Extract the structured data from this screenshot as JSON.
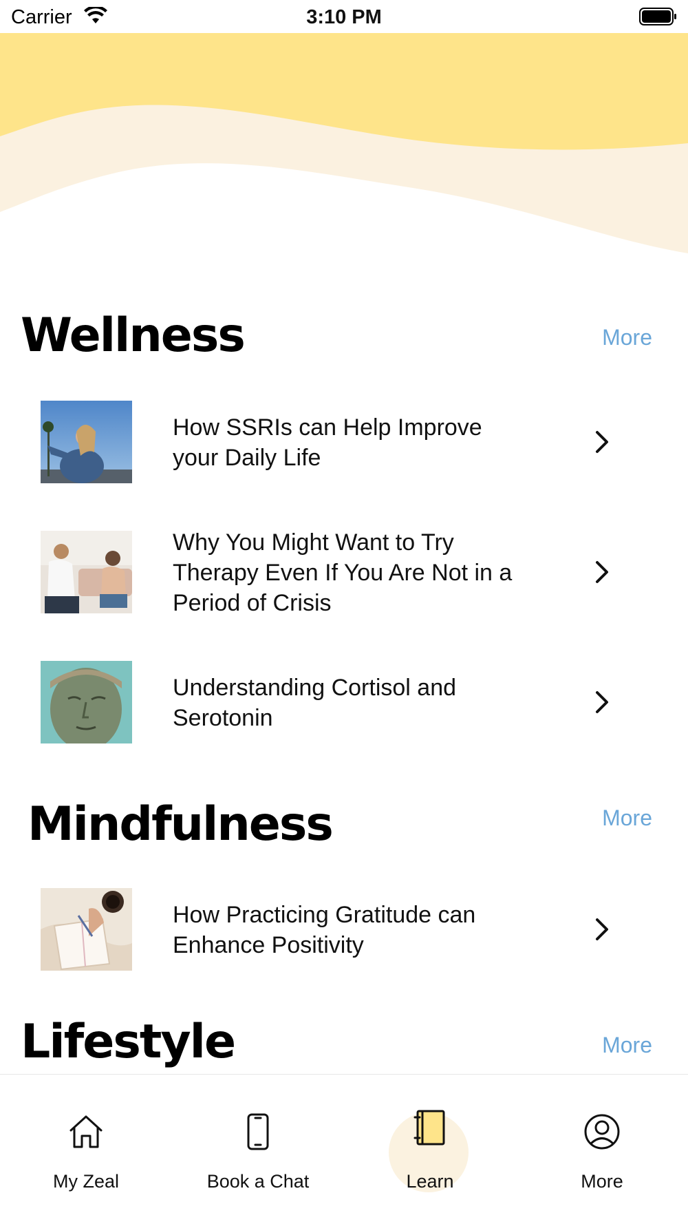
{
  "status": {
    "carrier": "Carrier",
    "time": "3:10 PM"
  },
  "colors": {
    "hero_yellow": "#fee48a",
    "hero_cream": "#fbf1e0",
    "link": "#6aa6d8",
    "tab_active_bg": "#fbf2e0"
  },
  "sections": [
    {
      "title": "Wellness",
      "more": "More",
      "articles": [
        {
          "title": "How SSRIs can Help Improve your Daily Life",
          "thumb": "woman-sky-photo"
        },
        {
          "title": "Why You Might Want to Try Therapy Even If You Are Not in a Period of Crisis",
          "thumb": "therapy-session-photo"
        },
        {
          "title": "Understanding Cortisol and Serotonin",
          "thumb": "statue-head-photo"
        }
      ]
    },
    {
      "title": "Mindfulness",
      "more": "More",
      "articles": [
        {
          "title": "How Practicing Gratitude can Enhance Positivity",
          "thumb": "journal-coffee-photo"
        }
      ]
    },
    {
      "title": "Lifestyle",
      "more": "More",
      "articles": []
    }
  ],
  "tabs": [
    {
      "label": "My Zeal",
      "icon": "home-icon",
      "active": false
    },
    {
      "label": "Book a Chat",
      "icon": "phone-icon",
      "active": false
    },
    {
      "label": "Learn",
      "icon": "book-icon",
      "active": true
    },
    {
      "label": "More",
      "icon": "profile-icon",
      "active": false
    }
  ]
}
